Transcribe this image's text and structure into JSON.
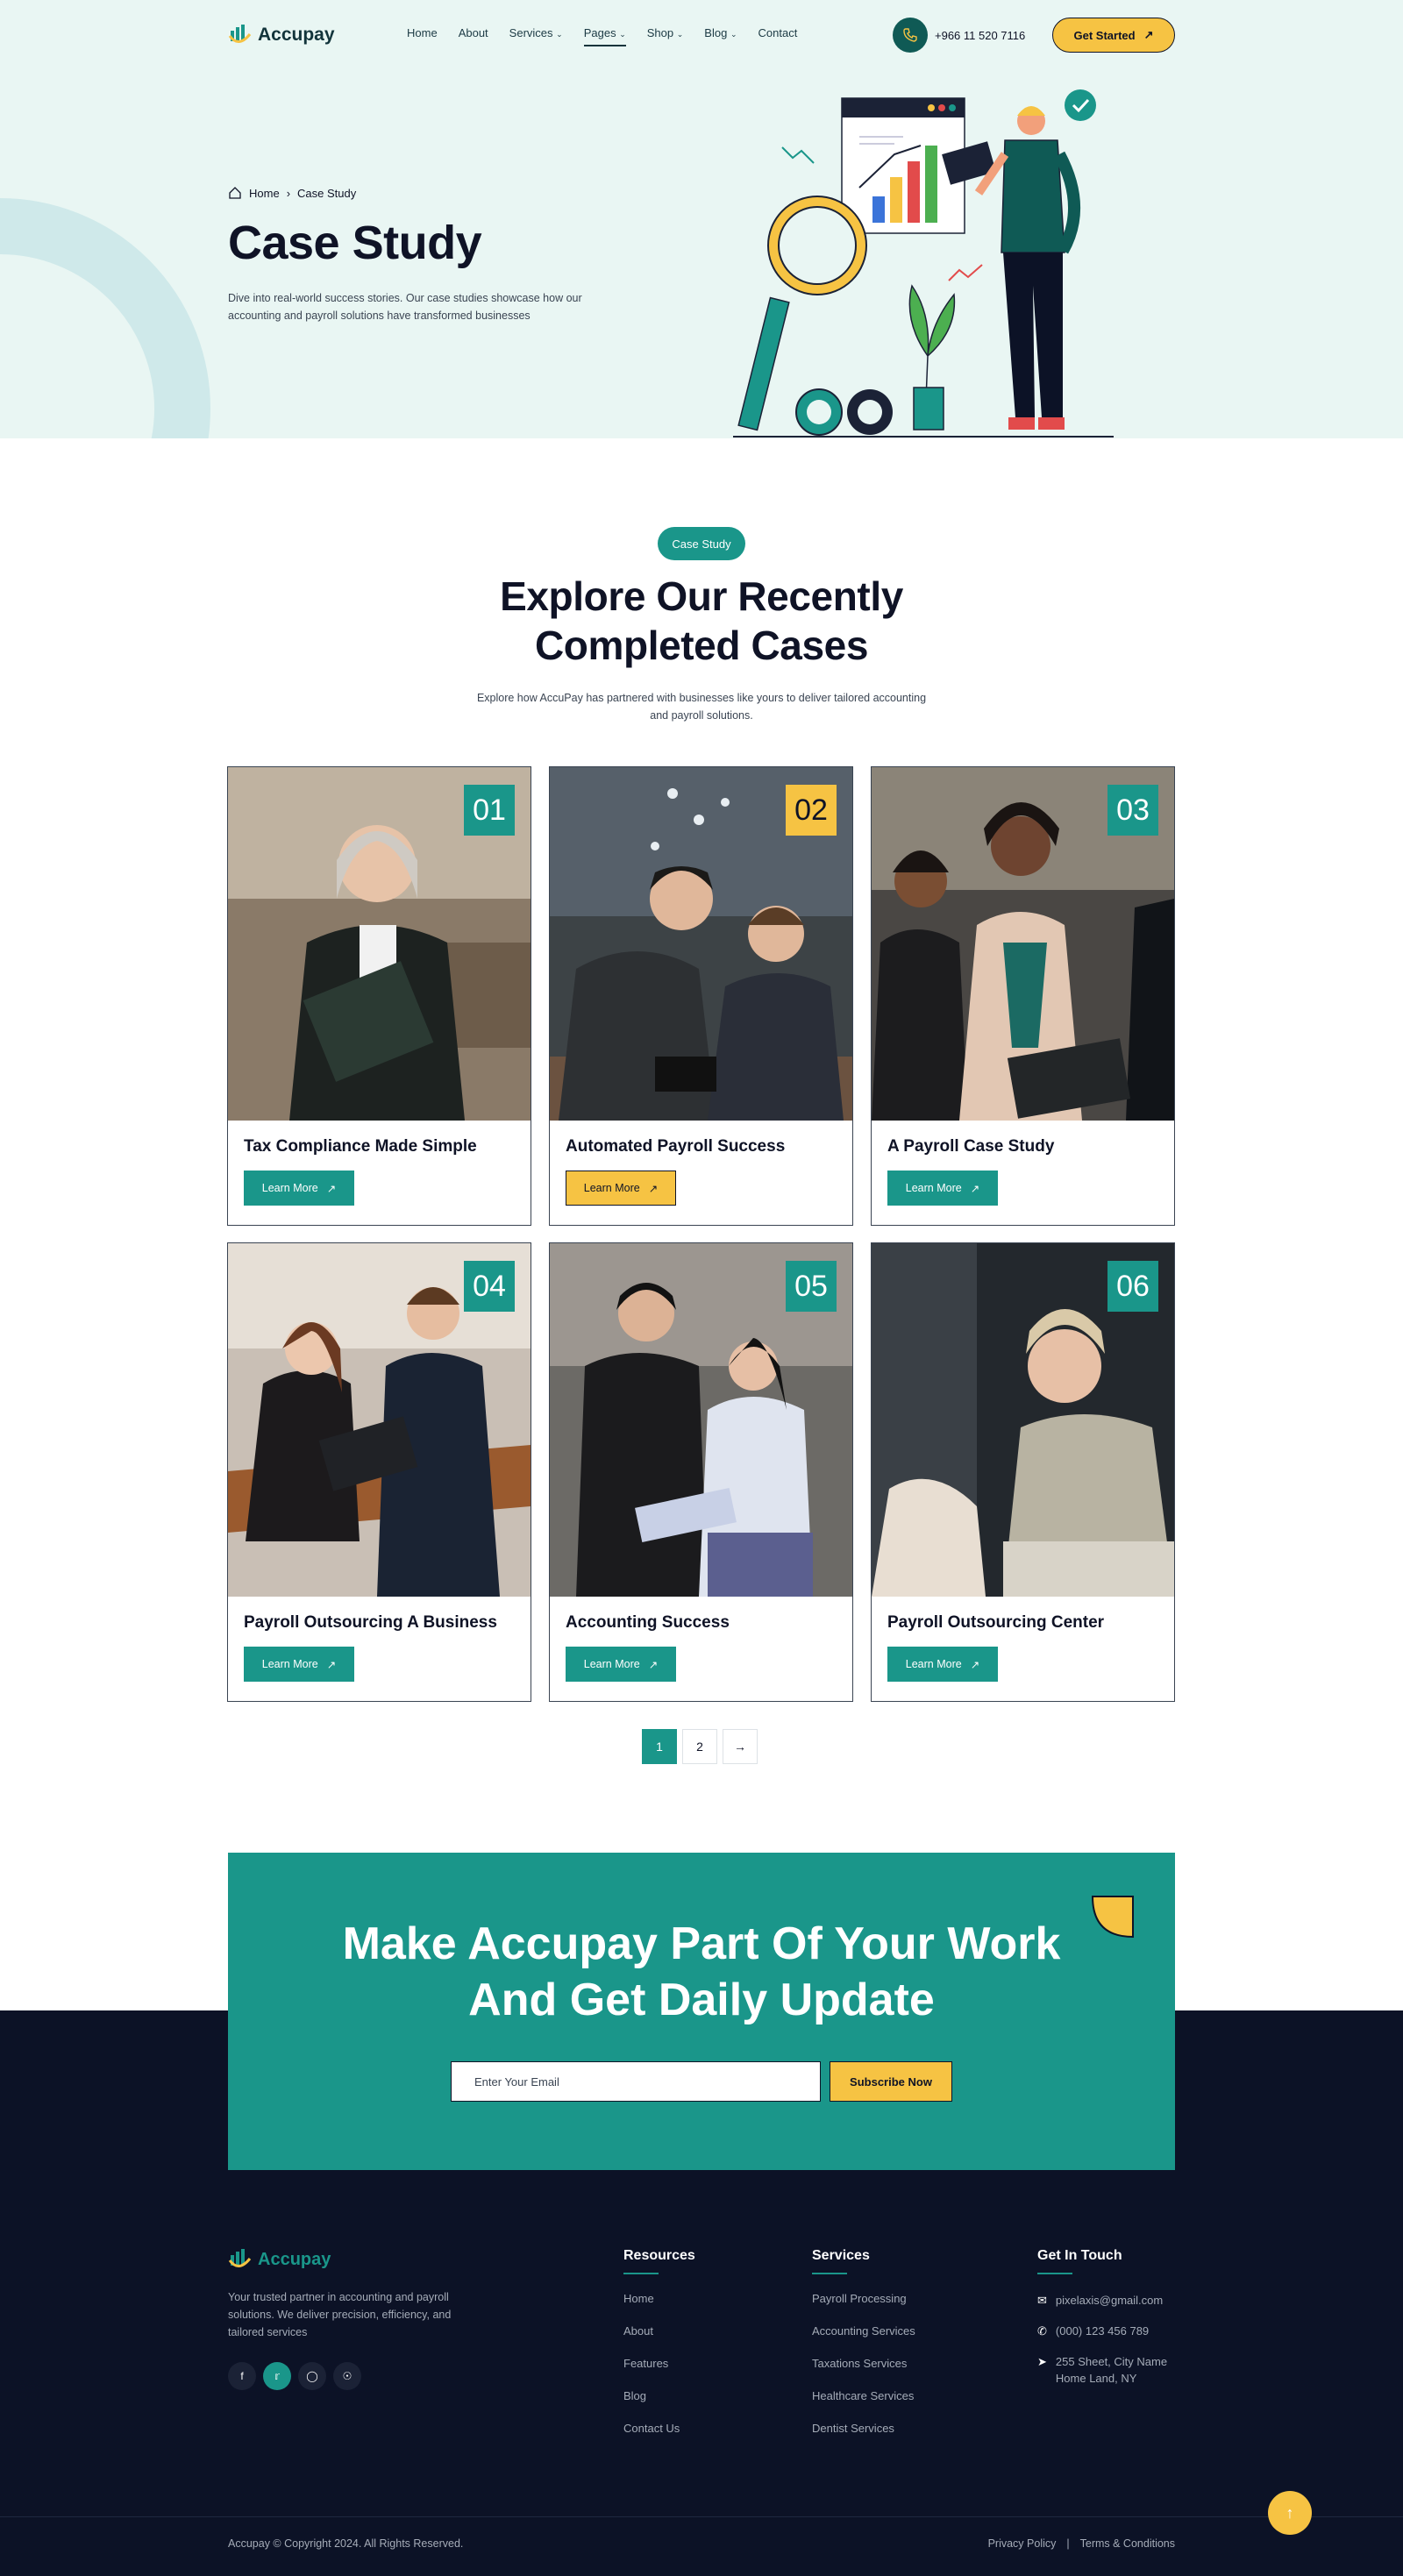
{
  "brand": {
    "name": "Accupay"
  },
  "nav": {
    "items": [
      {
        "label": "Home",
        "has_dropdown": false
      },
      {
        "label": "About",
        "has_dropdown": false
      },
      {
        "label": "Services",
        "has_dropdown": true
      },
      {
        "label": "Pages",
        "has_dropdown": true,
        "active": true
      },
      {
        "label": "Shop",
        "has_dropdown": true
      },
      {
        "label": "Blog",
        "has_dropdown": true
      },
      {
        "label": "Contact",
        "has_dropdown": false
      }
    ],
    "phone": "+966 11 520 7116",
    "cta": "Get Started"
  },
  "hero": {
    "breadcrumb": {
      "home": "Home",
      "current": "Case Study"
    },
    "title": "Case Study",
    "description": "Dive into real-world success stories. Our case studies showcase how our accounting and payroll solutions have transformed businesses"
  },
  "section": {
    "tag": "Case Study",
    "title_line1": "Explore Our Recently",
    "title_line2": "Completed Cases",
    "description": "Explore how AccuPay has partnered with businesses like yours to deliver tailored accounting and payroll solutions."
  },
  "cases": [
    {
      "number": "01",
      "title": "Tax Compliance Made Simple",
      "button": "Learn More",
      "highlight": false
    },
    {
      "number": "02",
      "title": "Automated Payroll Success",
      "button": "Learn More",
      "highlight": true
    },
    {
      "number": "03",
      "title": "A Payroll Case Study",
      "button": "Learn More",
      "highlight": false
    },
    {
      "number": "04",
      "title": "Payroll Outsourcing A Business",
      "button": "Learn More",
      "highlight": false
    },
    {
      "number": "05",
      "title": "Accounting Success",
      "button": "Learn More",
      "highlight": false
    },
    {
      "number": "06",
      "title": "Payroll Outsourcing Center",
      "button": "Learn More",
      "highlight": false
    }
  ],
  "pagination": {
    "pages": [
      "1",
      "2"
    ],
    "current": "1"
  },
  "cta": {
    "title_line1": "Make Accupay Part Of Your Work",
    "title_line2": "And Get Daily Update",
    "email_placeholder": "Enter Your Email",
    "button": "Subscribe Now"
  },
  "footer": {
    "description": "Your trusted partner in accounting and payroll solutions. We deliver precision, efficiency, and tailored services",
    "socials": [
      "facebook-icon",
      "twitter-icon",
      "instagram-icon",
      "dribbble-icon"
    ],
    "resources": {
      "heading": "Resources",
      "items": [
        "Home",
        "About",
        "Features",
        "Blog",
        "Contact Us"
      ]
    },
    "services": {
      "heading": "Services",
      "items": [
        "Payroll Processing",
        "Accounting Services",
        "Taxations Services",
        "Healthcare Services",
        "Dentist Services"
      ]
    },
    "contact": {
      "heading": "Get In Touch",
      "email": "pixelaxis@gmail.com",
      "phone": "(000) 123 456 789",
      "address_line1": "255 Sheet, City Name",
      "address_line2": "Home Land, NY"
    },
    "copyright": "Accupay © Copyright 2024. All Rights Reserved.",
    "privacy": "Privacy Policy",
    "separator": "|",
    "terms": "Terms & Conditions"
  },
  "colors": {
    "primary": "#1a968a",
    "accent": "#f6c343",
    "dark": "#0c1226",
    "hero_bg": "#e9f6f3"
  }
}
